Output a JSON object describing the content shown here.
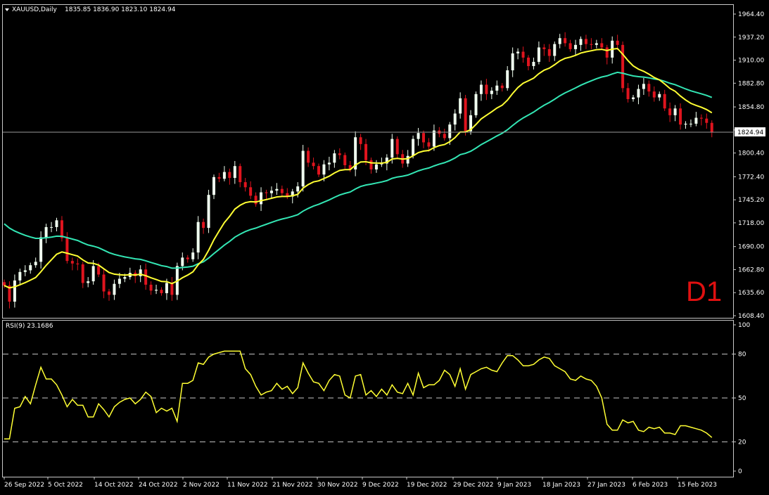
{
  "colors": {
    "background": "#000000",
    "grid_frame": "#c8c8c8",
    "bull_candle": "#f0fff0",
    "bear_candle": "#e0141e",
    "ma_fast": "#ffff33",
    "ma_slow": "#33e6b4",
    "rsi_line": "#ffff33",
    "timeframe_label": "#e01010"
  },
  "header": {
    "dropdown_icon": "triangle-down-icon",
    "symbol_timeframe": "XAUUSD,Daily",
    "ohlc": "1835.85 1836.90 1823.10 1824.94"
  },
  "timeframe_label": "D1",
  "rsi_header": "RSI(9) 23.1686",
  "chart_data": [
    {
      "type": "candlestick",
      "symbol": "XAUUSD",
      "timeframe": "Daily",
      "price_ticks": [
        "1964.40",
        "1937.20",
        "1910.00",
        "1882.80",
        "1854.80",
        "1827.60",
        "1800.40",
        "1772.40",
        "1745.20",
        "1718.00",
        "1690.00",
        "1662.80",
        "1635.60",
        "1608.40"
      ],
      "current_price": "1824.94",
      "ylim": [
        1601,
        1973
      ],
      "x_ticks": [
        "26 Sep 2022",
        "5 Oct 2022",
        "14 Oct 2022",
        "24 Oct 2022",
        "2 Nov 2022",
        "11 Nov 2022",
        "21 Nov 2022",
        "30 Nov 2022",
        "9 Dec 2022",
        "19 Dec 2022",
        "29 Dec 2022",
        "9 Jan 2023",
        "18 Jan 2023",
        "27 Jan 2023",
        "6 Feb 2023",
        "15 Feb 2023"
      ],
      "close": [
        1644,
        1625,
        1650,
        1660,
        1662,
        1668,
        1672,
        1701,
        1713,
        1713,
        1721,
        1700,
        1673,
        1670,
        1669,
        1647,
        1649,
        1667,
        1657,
        1637,
        1633,
        1646,
        1652,
        1654,
        1659,
        1655,
        1663,
        1645,
        1638,
        1639,
        1635,
        1647,
        1633,
        1667,
        1677,
        1675,
        1683,
        1719,
        1712,
        1751,
        1772,
        1770,
        1778,
        1771,
        1785,
        1766,
        1760,
        1750,
        1740,
        1754,
        1753,
        1756,
        1758,
        1753,
        1749,
        1755,
        1761,
        1803,
        1789,
        1785,
        1775,
        1787,
        1789,
        1800,
        1798,
        1786,
        1781,
        1819,
        1811,
        1792,
        1781,
        1787,
        1788,
        1795,
        1817,
        1799,
        1788,
        1797,
        1817,
        1824,
        1813,
        1808,
        1827,
        1823,
        1818,
        1834,
        1847,
        1865,
        1826,
        1845,
        1870,
        1881,
        1870,
        1874,
        1880,
        1877,
        1898,
        1918,
        1920,
        1913,
        1903,
        1908,
        1925,
        1923,
        1915,
        1929,
        1936,
        1930,
        1923,
        1928,
        1935,
        1929,
        1928,
        1930,
        1925,
        1913,
        1933,
        1928,
        1877,
        1864,
        1866,
        1876,
        1882,
        1873,
        1866,
        1870,
        1853,
        1845,
        1853,
        1834,
        1835,
        1835,
        1842,
        1841,
        1836,
        1825
      ],
      "ma_fast_description": "smoothed moving average (yellow)",
      "ma_slow_description": "smoothed moving average (teal)"
    },
    {
      "type": "line",
      "name": "RSI(9)",
      "current_value": "23.1686",
      "ylim": [
        0,
        100
      ],
      "y_ticks": [
        "100",
        "80",
        "50",
        "20",
        "0"
      ],
      "levels": [
        80,
        50,
        20
      ],
      "values": [
        22,
        22,
        43,
        44,
        51,
        46,
        59,
        71,
        63,
        63,
        59,
        52,
        44,
        49,
        45,
        45,
        37,
        37,
        46,
        42,
        37,
        44,
        47,
        49,
        50,
        46,
        49,
        54,
        51,
        40,
        43,
        41,
        43,
        34,
        60,
        60,
        62,
        74,
        73,
        78,
        80,
        81,
        82,
        82,
        82,
        82,
        70,
        66,
        58,
        52,
        54,
        55,
        60,
        56,
        58,
        53,
        57,
        74,
        67,
        61,
        60,
        55,
        62,
        66,
        65,
        52,
        50,
        65,
        66,
        52,
        55,
        51,
        56,
        52,
        59,
        54,
        53,
        60,
        52,
        67,
        57,
        59,
        59,
        62,
        69,
        66,
        58,
        70,
        56,
        66,
        68,
        70,
        71,
        69,
        68,
        74,
        79,
        79,
        76,
        72,
        72,
        73,
        76,
        78,
        77,
        72,
        70,
        68,
        63,
        62,
        65,
        63,
        62,
        58,
        50,
        32,
        28,
        28,
        35,
        33,
        34,
        28,
        27,
        30,
        29,
        30,
        26,
        26,
        25,
        31,
        31,
        30,
        29,
        28,
        26,
        23
      ],
      "x_ticks": [
        "26 Sep 2022",
        "5 Oct 2022",
        "14 Oct 2022",
        "24 Oct 2022",
        "2 Nov 2022",
        "11 Nov 2022",
        "21 Nov 2022",
        "30 Nov 2022",
        "9 Dec 2022",
        "19 Dec 2022",
        "29 Dec 2022",
        "9 Jan 2023",
        "18 Jan 2023",
        "27 Jan 2023",
        "6 Feb 2023",
        "15 Feb 2023"
      ]
    }
  ]
}
